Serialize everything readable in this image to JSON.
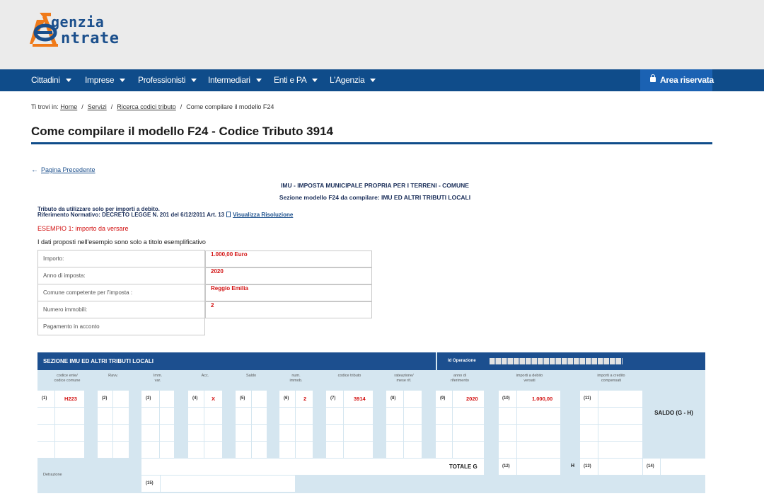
{
  "header": {
    "logo_line1": "genzia",
    "logo_line2": "ntrate",
    "colors": {
      "logo_blue": "#1b4f8c",
      "logo_orange": "#f07a19"
    }
  },
  "nav": {
    "items": [
      "Cittadini",
      "Imprese",
      "Professionisti",
      "Intermediari",
      "Enti e PA",
      "L’Agenzia"
    ],
    "reserved_label": "Area riservata",
    "colors": {
      "bar": "#0f4c8a",
      "reserved": "#1b62b3"
    }
  },
  "breadcrumb": {
    "prefix": "Ti trovi in:",
    "items": [
      "Home",
      "Servizi",
      "Ricerca codici tributo"
    ],
    "current": "Come compilare il modello F24"
  },
  "page": {
    "title": "Come compilare il modello F24 - Codice Tributo 3914",
    "back_link": "Pagina Precedente",
    "heading_imu": "IMU - IMPOSTA MUNICIPALE PROPRIA PER I TERRENI - COMUNE",
    "heading_section": "Sezione modello F24 da compilare: IMU ED ALTRI TRIBUTI LOCALI",
    "info_line1": "Tributo da utilizzare solo per importi a debito.",
    "info_line2": "Riferimento Normativo: DECRETO LEGGE  N. 201 del 6/12/2011 Art. 13",
    "info_link": "Visualizza Risoluzione",
    "example_title": "ESEMPIO 1: importo da versare",
    "disclaimer": "I dati proposti nell'esempio sono solo a titolo esemplificativo"
  },
  "example_table": [
    {
      "label": "Importo:",
      "value": "1.000,00 Euro"
    },
    {
      "label": "Anno di imposta:",
      "value": "2020"
    },
    {
      "label": "Comune competente per l'imposta :",
      "value": "Reggio Emilia"
    },
    {
      "label": "Numero immobili:",
      "value": "2"
    },
    {
      "label": "Pagamento in acconto",
      "value": ""
    }
  ],
  "f24": {
    "title": "SEZIONE IMU ED ALTRI TRIBUTI LOCALI",
    "id_operazione": "Id Operazione",
    "columns": {
      "c1_l1": "codice ente/",
      "c1_l2": "codice comune",
      "c2": "Ravv.",
      "c3_l1": "Imm.",
      "c3_l2": "var.",
      "c4": "Acc.",
      "c5": "Saldo",
      "c6_l1": "num.",
      "c6_l2": "immob.",
      "c7": "codice tributo",
      "c8_l1": "rateazione/",
      "c8_l2": "mese rif.",
      "c9_l1": "anno di",
      "c9_l2": "riferimento",
      "c10_l1": "importi a debito",
      "c10_l2": "versati",
      "c11_l1": "importi a credito",
      "c11_l2": "compensati"
    },
    "fields": {
      "n1": "(1)",
      "v1": "H223",
      "n2": "(2)",
      "n3": "(3)",
      "n4": "(4)",
      "v4": "X",
      "n5": "(5)",
      "n6": "(6)",
      "v6": "2",
      "n7": "(7)",
      "v7": "3914",
      "n8": "(8)",
      "n9": "(9)",
      "v9": "2020",
      "n10": "(10)",
      "v10": "1.000,00",
      "n11": "(11)",
      "n12": "(12)",
      "n13": "(13)",
      "n14": "(14)",
      "n15": "(15)"
    },
    "saldo": "SALDO (G - H)",
    "totale": "TOTALE  G",
    "h_label": "H",
    "detrazione": "Detrazione",
    "colors": {
      "header": "#1c4f8f",
      "panel": "#d5e6f0",
      "value": "#d21010"
    }
  }
}
